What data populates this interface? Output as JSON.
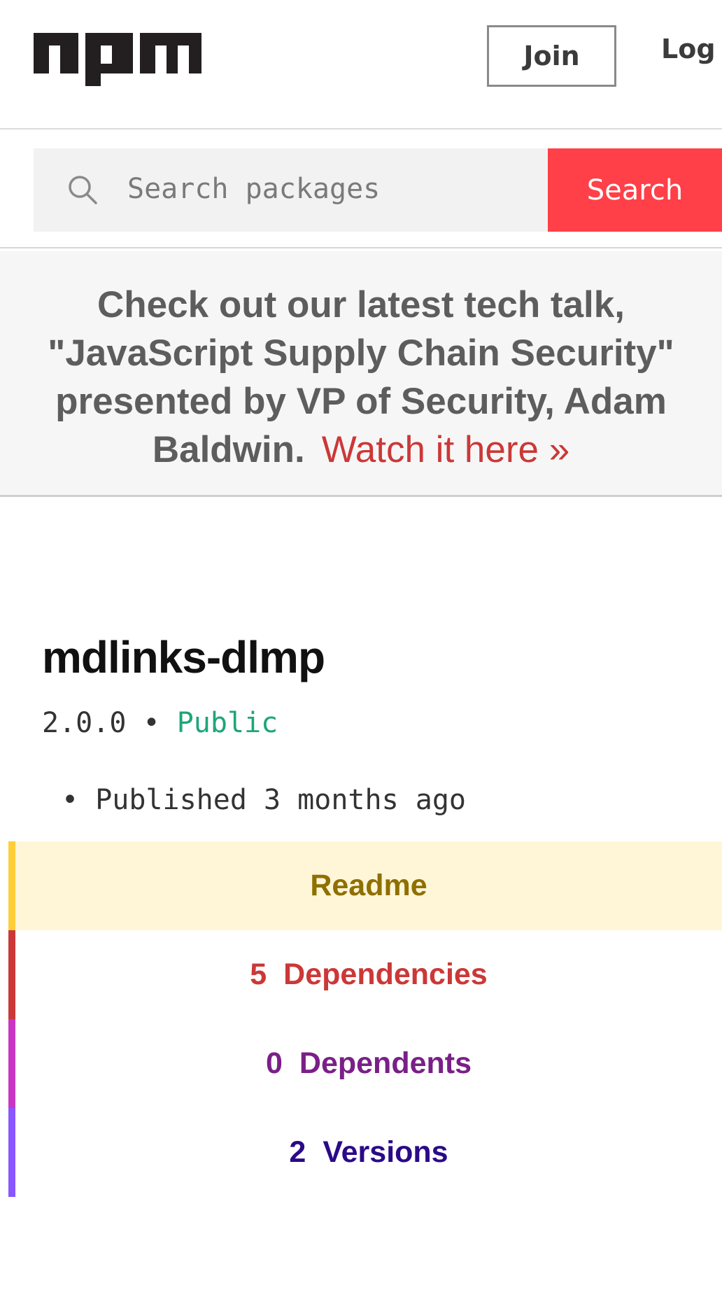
{
  "header": {
    "logo_alt": "npm",
    "join_label": "Join",
    "login_label": "Log"
  },
  "search": {
    "placeholder": "Search packages",
    "button_label": "Search"
  },
  "banner": {
    "text": "Check out our latest tech talk, \"JavaScript Supply Chain Security\" presented by VP of Security, Adam Baldwin.",
    "link_label": "Watch it here »"
  },
  "package": {
    "name": "mdlinks-dlmp",
    "version": "2.0.0",
    "separator": "•",
    "visibility": "Public",
    "published_bullet": "•",
    "published": "Published 3 months ago"
  },
  "tabs": [
    {
      "count": "",
      "label": "Readme"
    },
    {
      "count": "5",
      "label": "Dependencies"
    },
    {
      "count": "0",
      "label": "Dependents"
    },
    {
      "count": "2",
      "label": "Versions"
    }
  ],
  "colors": {
    "search_button": "#ff4048",
    "link": "#cb3837",
    "public": "#1ea57a",
    "readme_bar": "#ffcd3a",
    "dependencies_bar": "#cb3837",
    "dependents_bar": "#c836c3",
    "versions_bar": "#8956ff"
  }
}
